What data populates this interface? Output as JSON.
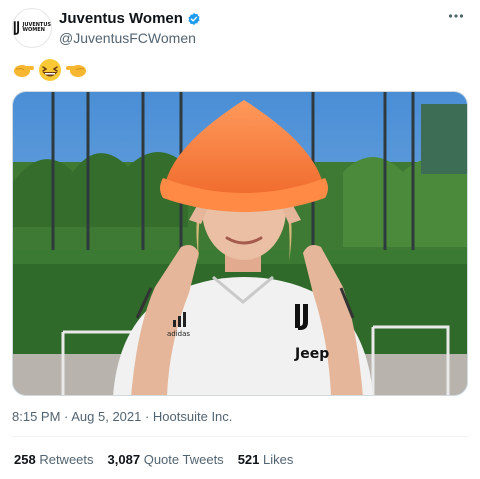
{
  "account": {
    "display_name": "Juventus Women",
    "handle": "@JuventusFCWomen",
    "avatar_text_1": "JUVENTUS",
    "avatar_text_2": "WOMEN"
  },
  "tweet": {
    "emoji_text": "👉😆👈",
    "timestamp": "8:15 PM · Aug 5, 2021 · Hootsuite Inc.",
    "image_alt_jersey_brand": "Jeep"
  },
  "stats": {
    "retweets_count": "258",
    "retweets_label": "Retweets",
    "quotes_count": "3,087",
    "quotes_label": "Quote Tweets",
    "likes_count": "521",
    "likes_label": "Likes"
  },
  "colors": {
    "verified_blue": "#1d9bf0",
    "cone_orange": "#f47a3c",
    "sky": "#5f9ed8",
    "hedge": "#2f6a2a"
  },
  "icons": [
    "verified-badge-icon",
    "more-options-icon",
    "juventus-logo-icon"
  ]
}
